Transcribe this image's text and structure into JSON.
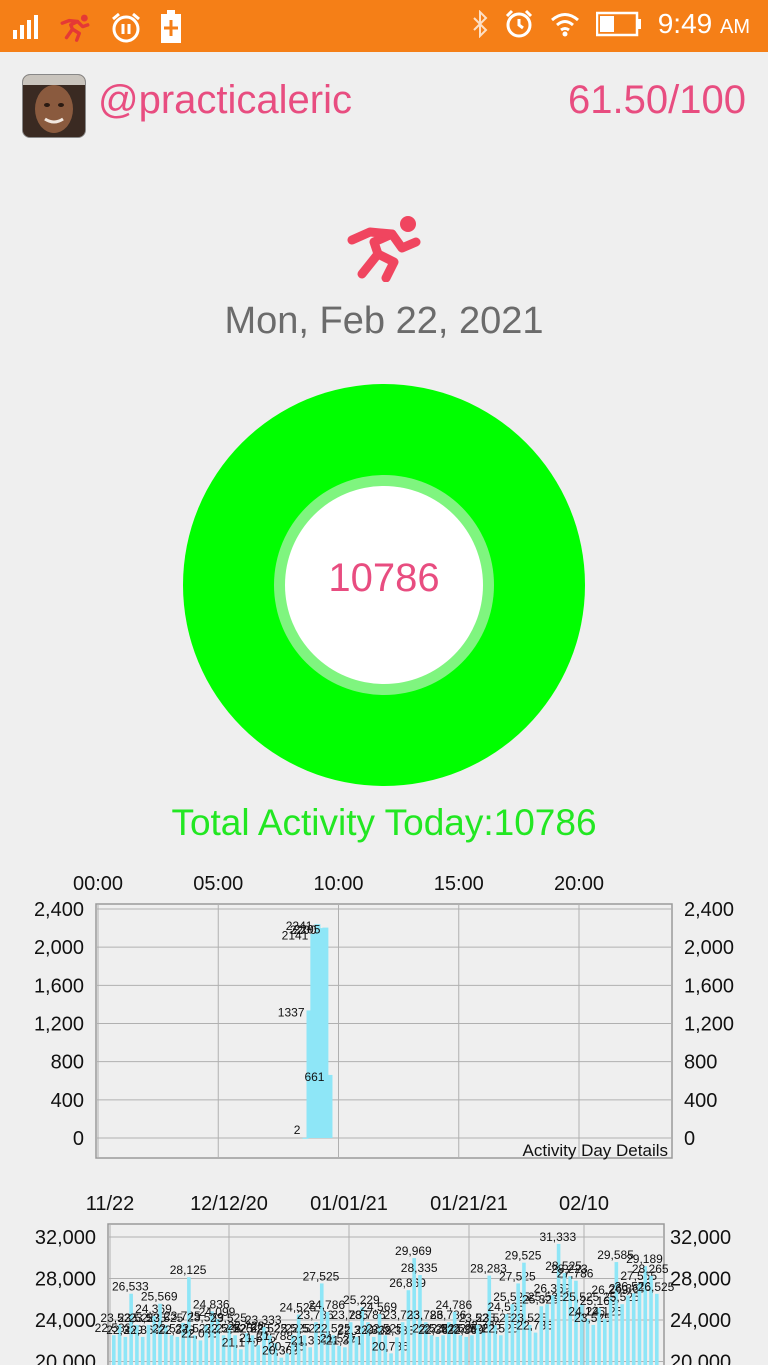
{
  "status_bar": {
    "time": "9:49",
    "ampm": "AM",
    "icons": [
      "signal-icon",
      "runner-notification-icon",
      "alarm-notification-icon",
      "battery-charging-notification-icon",
      "bluetooth-icon",
      "alarm-icon",
      "wifi-icon",
      "battery-icon"
    ]
  },
  "header": {
    "username": "@practicaleric",
    "score": "61.50/100"
  },
  "main": {
    "icon": "running-man-icon",
    "date": "Mon, Feb 22, 2021",
    "ring_value": "10786",
    "total_label": "Total Activity Today:10786"
  },
  "colors": {
    "status_bar": "#f57f17",
    "accent_pink": "#e84d80",
    "ring_green": "#00ff00",
    "total_green": "#22e722",
    "bar_blue": "#8ee6f7"
  },
  "chart_data": [
    {
      "type": "bar",
      "title": "Activity Day Details",
      "xlabel": "",
      "ylabel": "",
      "x_ticks": [
        "00:00",
        "05:00",
        "10:00",
        "15:00",
        "20:00"
      ],
      "y_ticks": [
        "2,400",
        "2,000",
        "1,600",
        "1,200",
        "800",
        "400",
        "0"
      ],
      "ylim": [
        0,
        2500
      ],
      "xlim_hours": [
        0,
        24
      ],
      "grid": true,
      "points": [
        {
          "hour": 8.5,
          "value": 2,
          "label": "2"
        },
        {
          "hour": 8.67,
          "value": 1337,
          "label": "1337"
        },
        {
          "hour": 8.83,
          "value": 2141,
          "label": "2141"
        },
        {
          "hour": 9.0,
          "value": 2241,
          "label": "2241"
        },
        {
          "hour": 9.17,
          "value": 2200,
          "label": "2200"
        },
        {
          "hour": 9.33,
          "value": 2205,
          "label": "2205"
        },
        {
          "hour": 9.5,
          "value": 661,
          "label": "661"
        }
      ]
    },
    {
      "type": "bar",
      "title": "",
      "x_ticks": [
        "11/22",
        "12/12/20",
        "01/01/21",
        "01/21/21",
        "02/10"
      ],
      "y_ticks": [
        "32,000",
        "28,000",
        "24,000",
        "20,000"
      ],
      "ylim": [
        20000,
        33500
      ],
      "grid": true,
      "values": [
        22533,
        23525,
        22369,
        26533,
        23525,
        22369,
        23525,
        24369,
        25569,
        23525,
        22525,
        22369,
        23725,
        28125,
        22525,
        22033,
        23559,
        24836,
        24099,
        22525,
        23525,
        22525,
        21170,
        22728,
        22525,
        21575,
        23333,
        22525,
        21788,
        20369,
        20786,
        22525,
        24525,
        22525,
        21369,
        23786,
        27525,
        24786,
        22525,
        21525,
        21371,
        23786,
        22369,
        25229,
        23786,
        22369,
        24569,
        22525,
        20786,
        22333,
        23786,
        26869,
        29969,
        28335,
        23786,
        22525,
        22369,
        22525,
        23786,
        24786,
        22525,
        22369,
        22525,
        23525,
        22786,
        28283,
        23525,
        22525,
        24565,
        25525,
        27525,
        29525,
        23525,
        22786,
        25325,
        25525,
        26369,
        31333,
        28525,
        28223,
        27786,
        25525,
        24125,
        23525,
        25169,
        24125,
        26209,
        29585,
        25525,
        26369,
        26575,
        27565,
        29189,
        28265,
        26525
      ]
    }
  ]
}
